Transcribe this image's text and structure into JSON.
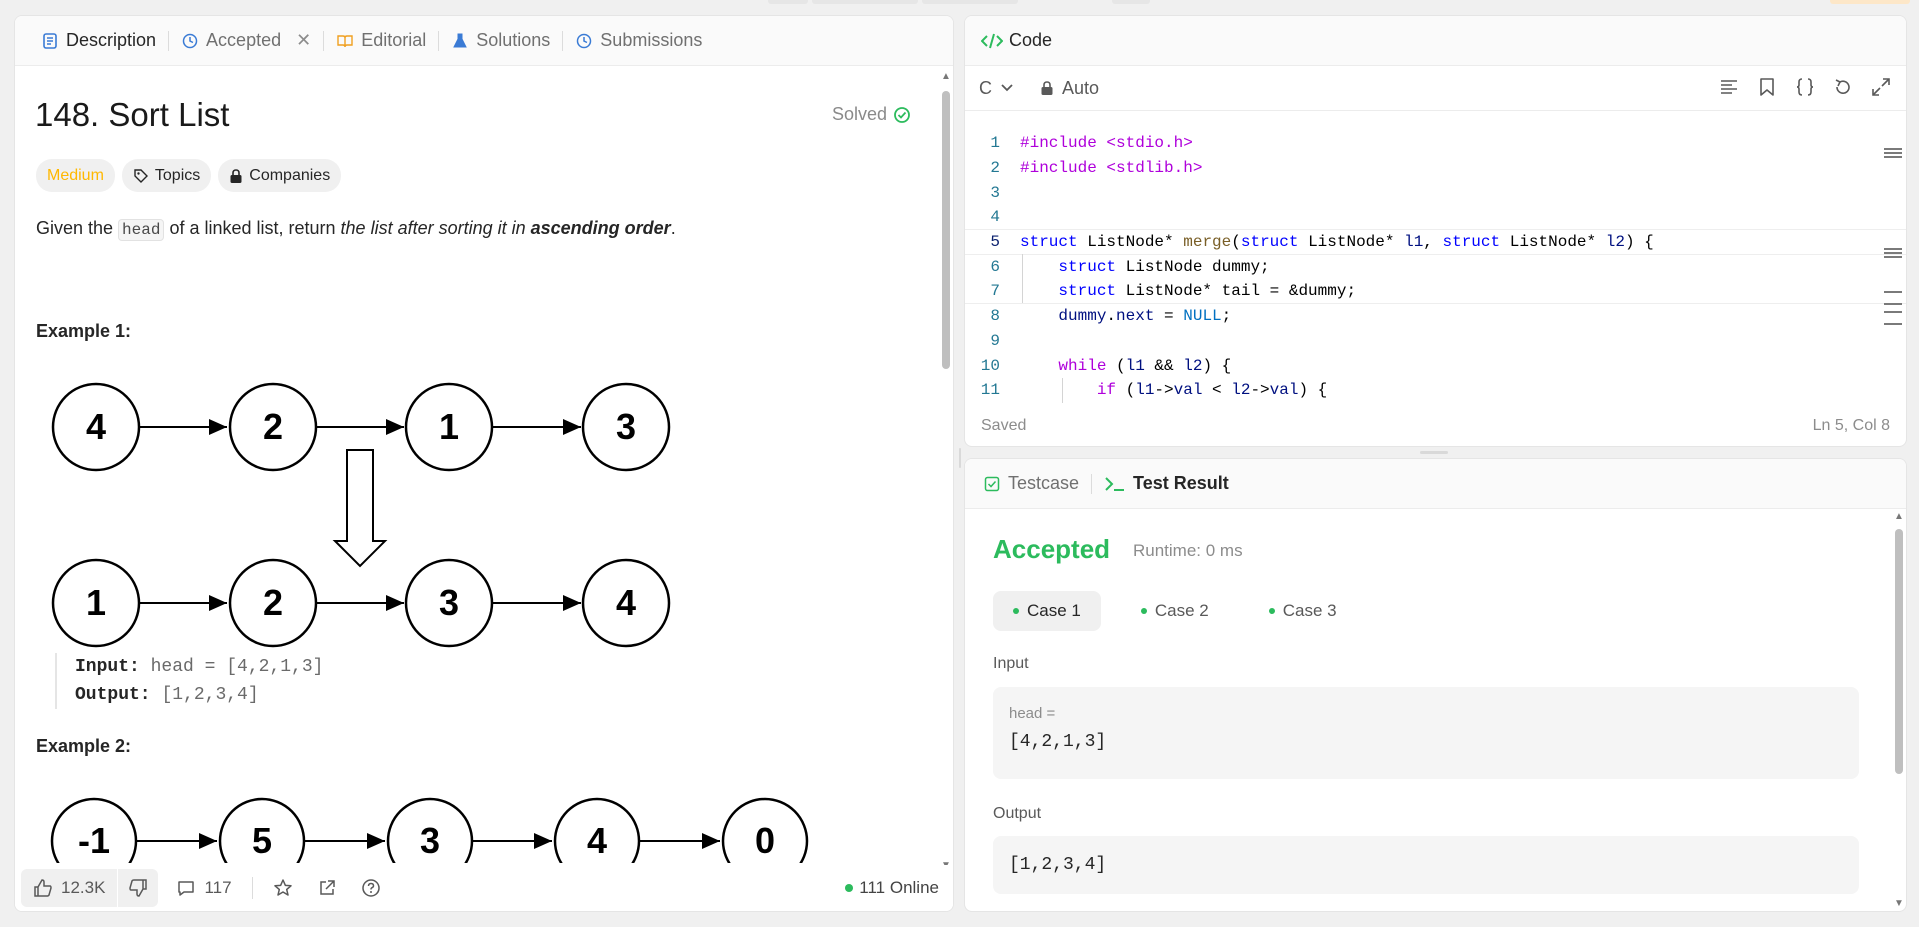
{
  "left_tabs": [
    {
      "label": "Description",
      "icon": "description-icon"
    },
    {
      "label": "Accepted",
      "icon": "history-icon"
    },
    {
      "label": "Editorial",
      "icon": "book-icon"
    },
    {
      "label": "Solutions",
      "icon": "flask-icon"
    },
    {
      "label": "Submissions",
      "icon": "history-icon"
    }
  ],
  "problem": {
    "title": "148. Sort List",
    "solved_label": "Solved",
    "tags": {
      "difficulty": "Medium",
      "topics": "Topics",
      "companies": "Companies"
    },
    "statement": {
      "pre": "Given the ",
      "code": "head",
      "mid": " of a linked list, return ",
      "italic": "the list after sorting it in ",
      "bold": "ascending order",
      "end": "."
    },
    "example1": {
      "heading": "Example 1:",
      "list_before": [
        "4",
        "2",
        "1",
        "3"
      ],
      "list_after": [
        "1",
        "2",
        "3",
        "4"
      ],
      "input_label": "Input:",
      "input_value": "head = [4,2,1,3]",
      "output_label": "Output:",
      "output_value": "[1,2,3,4]"
    },
    "example2": {
      "heading": "Example 2:",
      "list_before": [
        "-1",
        "5",
        "3",
        "4",
        "0"
      ]
    }
  },
  "footer": {
    "likes": "12.3K",
    "comments": "117",
    "online": "111 Online"
  },
  "code_panel": {
    "title": "Code",
    "language": "C",
    "mode": "Auto",
    "status": "Saved",
    "cursor": "Ln 5, Col 8",
    "lines": [
      "1",
      "2",
      "3",
      "4",
      "5",
      "6",
      "7",
      "8",
      "9",
      "10",
      "11"
    ]
  },
  "result_panel": {
    "tabs": {
      "testcase": "Testcase",
      "result": "Test Result"
    },
    "verdict": "Accepted",
    "runtime": "Runtime: 0 ms",
    "cases": [
      "Case 1",
      "Case 2",
      "Case 3"
    ],
    "input_label": "Input",
    "input_var": "head =",
    "input_value": "[4,2,1,3]",
    "output_label": "Output",
    "output_value": "[1,2,3,4]"
  },
  "colors": {
    "accepted": "#2cbb5d",
    "medium": "#ffb800",
    "accent_blue": "#3a7bd5"
  }
}
